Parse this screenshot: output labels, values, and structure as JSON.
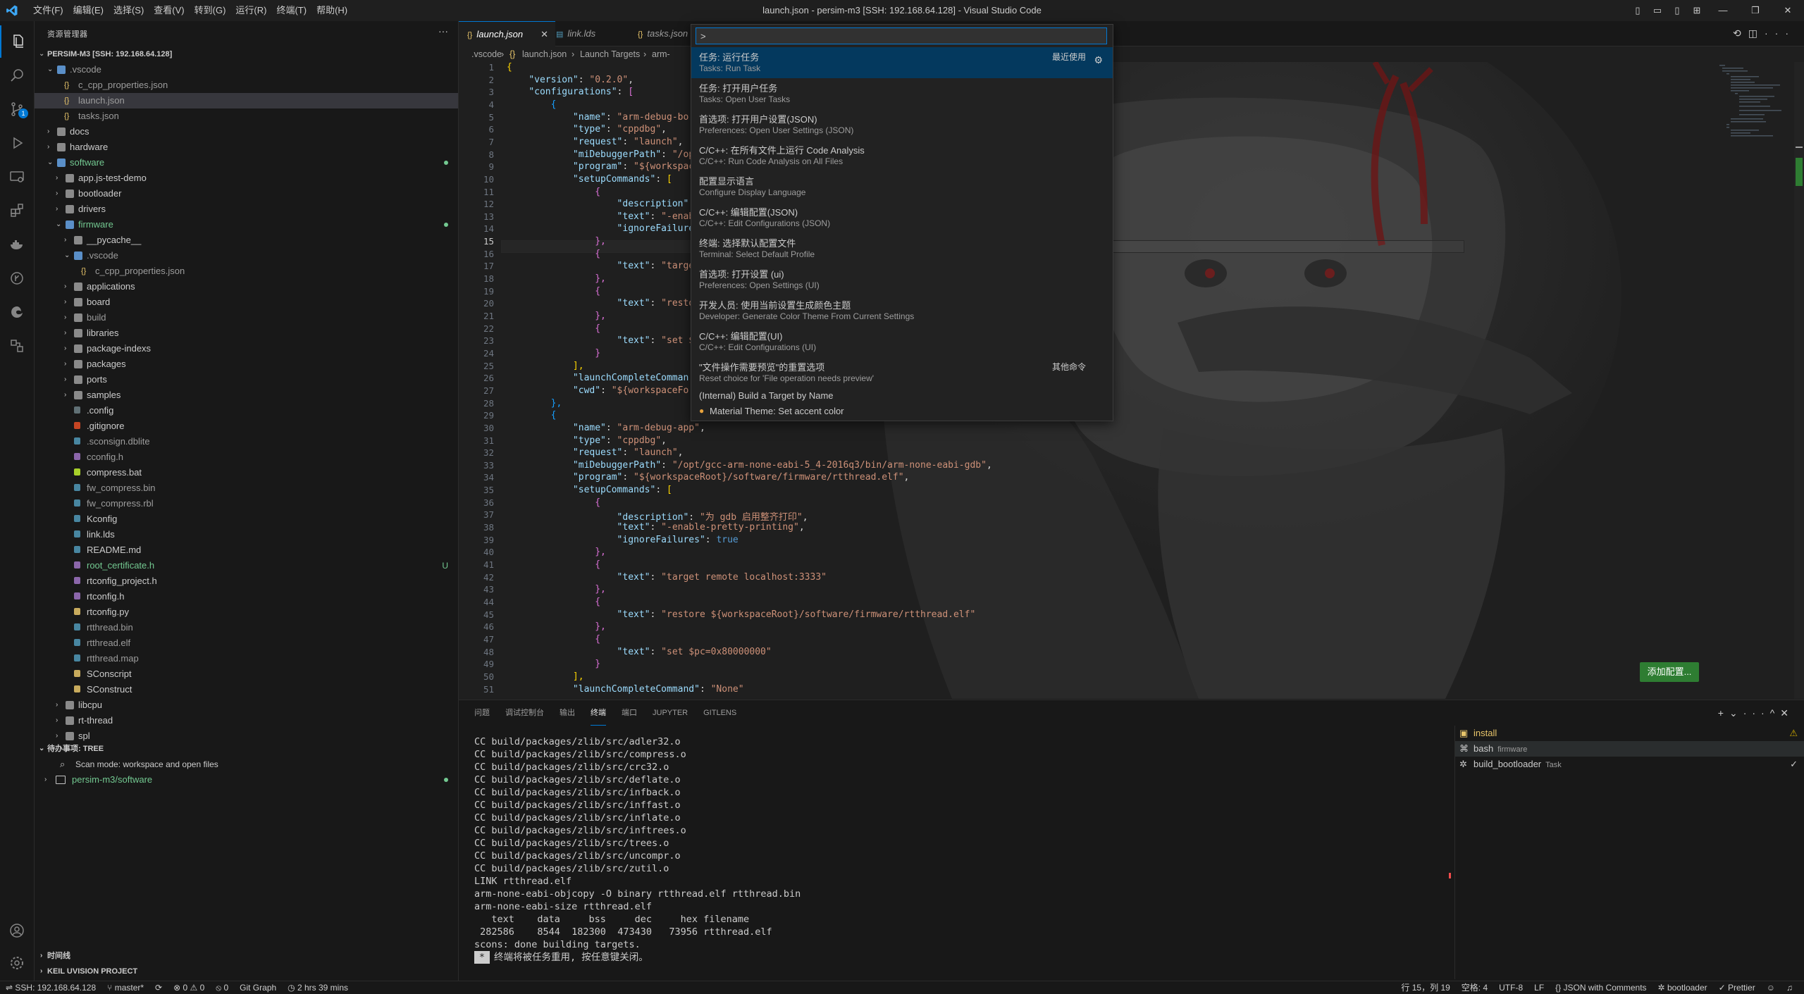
{
  "window": {
    "menus": [
      "文件(F)",
      "编辑(E)",
      "选择(S)",
      "查看(V)",
      "转到(G)",
      "运行(R)",
      "终端(T)",
      "帮助(H)"
    ],
    "title": "launch.json - persim-m3 [SSH: 192.168.64.128] - Visual Studio Code"
  },
  "activity": {
    "scm_badge": "1"
  },
  "sidebar": {
    "title": "资源管理器",
    "root": "PERSIM-M3 [SSH: 192.168.64.128]",
    "items": [
      {
        "label": ".vscode",
        "depth": 1,
        "kind": "folder-open",
        "color": "#9d9d9d"
      },
      {
        "label": "c_cpp_properties.json",
        "depth": 2,
        "kind": "json",
        "color": "#9d9d9d"
      },
      {
        "label": "launch.json",
        "depth": 2,
        "kind": "json",
        "color": "#9d9d9d",
        "selected": true
      },
      {
        "label": "tasks.json",
        "depth": 2,
        "kind": "json",
        "color": "#9d9d9d"
      },
      {
        "label": "docs",
        "depth": 1,
        "kind": "folder"
      },
      {
        "label": "hardware",
        "depth": 1,
        "kind": "folder"
      },
      {
        "label": "software",
        "depth": 1,
        "kind": "folder-open",
        "color": "#73c991",
        "dot": true
      },
      {
        "label": "app.js-test-demo",
        "depth": 2,
        "kind": "folder"
      },
      {
        "label": "bootloader",
        "depth": 2,
        "kind": "folder"
      },
      {
        "label": "drivers",
        "depth": 2,
        "kind": "folder"
      },
      {
        "label": "firmware",
        "depth": 2,
        "kind": "folder-open",
        "color": "#73c991",
        "dot": true
      },
      {
        "label": "__pycache__",
        "depth": 3,
        "kind": "folder"
      },
      {
        "label": ".vscode",
        "depth": 3,
        "kind": "folder-open",
        "color": "#9d9d9d"
      },
      {
        "label": "c_cpp_properties.json",
        "depth": 4,
        "kind": "json",
        "color": "#9d9d9d"
      },
      {
        "label": "applications",
        "depth": 3,
        "kind": "folder"
      },
      {
        "label": "board",
        "depth": 3,
        "kind": "folder"
      },
      {
        "label": "build",
        "depth": 3,
        "kind": "folder",
        "color": "#9d9d9d"
      },
      {
        "label": "libraries",
        "depth": 3,
        "kind": "folder"
      },
      {
        "label": "package-indexs",
        "depth": 3,
        "kind": "folder"
      },
      {
        "label": "packages",
        "depth": 3,
        "kind": "folder"
      },
      {
        "label": "ports",
        "depth": 3,
        "kind": "folder"
      },
      {
        "label": "samples",
        "depth": 3,
        "kind": "folder"
      },
      {
        "label": ".config",
        "depth": 3,
        "kind": "file"
      },
      {
        "label": ".gitignore",
        "depth": 3,
        "kind": "file"
      },
      {
        "label": ".sconsign.dblite",
        "depth": 3,
        "kind": "file",
        "color": "#9d9d9d"
      },
      {
        "label": "cconfig.h",
        "depth": 3,
        "kind": "file",
        "color": "#9d9d9d"
      },
      {
        "label": "compress.bat",
        "depth": 3,
        "kind": "file"
      },
      {
        "label": "fw_compress.bin",
        "depth": 3,
        "kind": "file",
        "color": "#9d9d9d"
      },
      {
        "label": "fw_compress.rbl",
        "depth": 3,
        "kind": "file",
        "color": "#9d9d9d"
      },
      {
        "label": "Kconfig",
        "depth": 3,
        "kind": "file"
      },
      {
        "label": "link.lds",
        "depth": 3,
        "kind": "file"
      },
      {
        "label": "README.md",
        "depth": 3,
        "kind": "file"
      },
      {
        "label": "root_certificate.h",
        "depth": 3,
        "kind": "file",
        "color": "#73c991",
        "flag": "U"
      },
      {
        "label": "rtconfig_project.h",
        "depth": 3,
        "kind": "file"
      },
      {
        "label": "rtconfig.h",
        "depth": 3,
        "kind": "file"
      },
      {
        "label": "rtconfig.py",
        "depth": 3,
        "kind": "file"
      },
      {
        "label": "rtthread.bin",
        "depth": 3,
        "kind": "file",
        "color": "#9d9d9d"
      },
      {
        "label": "rtthread.elf",
        "depth": 3,
        "kind": "file",
        "color": "#9d9d9d"
      },
      {
        "label": "rtthread.map",
        "depth": 3,
        "kind": "file",
        "color": "#9d9d9d"
      },
      {
        "label": "SConscript",
        "depth": 3,
        "kind": "file"
      },
      {
        "label": "SConstruct",
        "depth": 3,
        "kind": "file"
      },
      {
        "label": "libcpu",
        "depth": 2,
        "kind": "folder"
      },
      {
        "label": "rt-thread",
        "depth": 2,
        "kind": "folder"
      },
      {
        "label": "spl",
        "depth": 2,
        "kind": "folder"
      }
    ],
    "todo_section": "待办事项: TREE",
    "todo_scan": "Scan mode: workspace and open files",
    "todo_root": "persim-m3/software",
    "timeline_section": "时间线",
    "keil_section": "KEIL UVISION PROJECT"
  },
  "tabs": [
    {
      "label": "launch.json",
      "active": true
    },
    {
      "label": "link.lds"
    },
    {
      "label": "tasks.json"
    }
  ],
  "breadcrumb": [
    ".vscode",
    "launch.json",
    "Launch Targets",
    "arm-"
  ],
  "editor": {
    "current_line": 15,
    "add_config_button": "添加配置..."
  },
  "palette": {
    "input_value": ">",
    "items": [
      {
        "title": "任务: 运行任务",
        "sub": "Tasks: Run Task",
        "tag": "最近使用",
        "selected": true
      },
      {
        "title": "任务: 打开用户任务",
        "sub": "Tasks: Open User Tasks"
      },
      {
        "title": "首选项: 打开用户设置(JSON)",
        "sub": "Preferences: Open User Settings (JSON)"
      },
      {
        "title": "C/C++: 在所有文件上运行 Code Analysis",
        "sub": "C/C++: Run Code Analysis on All Files"
      },
      {
        "title": "配置显示语言",
        "sub": "Configure Display Language"
      },
      {
        "title": "C/C++: 编辑配置(JSON)",
        "sub": "C/C++: Edit Configurations (JSON)"
      },
      {
        "title": "终端: 选择默认配置文件",
        "sub": "Terminal: Select Default Profile"
      },
      {
        "title": "首选项: 打开设置 (ui)",
        "sub": "Preferences: Open Settings (UI)"
      },
      {
        "title": "开发人员: 使用当前设置生成颜色主题",
        "sub": "Developer: Generate Color Theme From Current Settings"
      },
      {
        "title": "C/C++: 编辑配置(UI)",
        "sub": "C/C++: Edit Configurations (UI)"
      },
      {
        "title": "\"文件操作需要预览\"的重置选项",
        "sub": "Reset choice for 'File operation needs preview'",
        "tag": "其他命令"
      }
    ],
    "singles": [
      "(Internal) Build a Target by Name",
      "Material Theme: Set accent color"
    ]
  },
  "panel": {
    "tabs": [
      "问题",
      "调试控制台",
      "输出",
      "终端",
      "端口",
      "JUPYTER",
      "GITLENS"
    ],
    "active_tab": "终端",
    "terminal_lines": [
      "CC build/packages/zlib/src/adler32.o",
      "CC build/packages/zlib/src/compress.o",
      "CC build/packages/zlib/src/crc32.o",
      "CC build/packages/zlib/src/deflate.o",
      "CC build/packages/zlib/src/infback.o",
      "CC build/packages/zlib/src/inffast.o",
      "CC build/packages/zlib/src/inflate.o",
      "CC build/packages/zlib/src/inftrees.o",
      "CC build/packages/zlib/src/trees.o",
      "CC build/packages/zlib/src/uncompr.o",
      "CC build/packages/zlib/src/zutil.o",
      "LINK rtthread.elf",
      "arm-none-eabi-objcopy -O binary rtthread.elf rtthread.bin",
      "arm-none-eabi-size rtthread.elf",
      "   text    data     bss     dec     hex filename",
      " 282586    8544  182300  473430   73956 rtthread.elf",
      "scons: done building targets."
    ],
    "terminal_last": "终端将被任务重用, 按任意键关闭。",
    "terminals": [
      {
        "name": "install",
        "desc": "",
        "icon": "warning"
      },
      {
        "name": "bash",
        "desc": "firmware",
        "selected": true
      },
      {
        "name": "build_bootloader",
        "desc": "Task",
        "icon": "check"
      }
    ]
  },
  "status": {
    "remote": "SSH: 192.168.64.128",
    "branch": "master*",
    "problems": "⊗ 0 ⚠ 0",
    "ports": "0",
    "git_graph": "Git Graph",
    "timer": "2 hrs 39 mins",
    "position": "行 15，列 19",
    "spaces": "空格: 4",
    "encoding": "UTF-8",
    "eol": "LF",
    "language": "JSON with Comments",
    "task": "bootloader",
    "prettier": "Prettier"
  }
}
